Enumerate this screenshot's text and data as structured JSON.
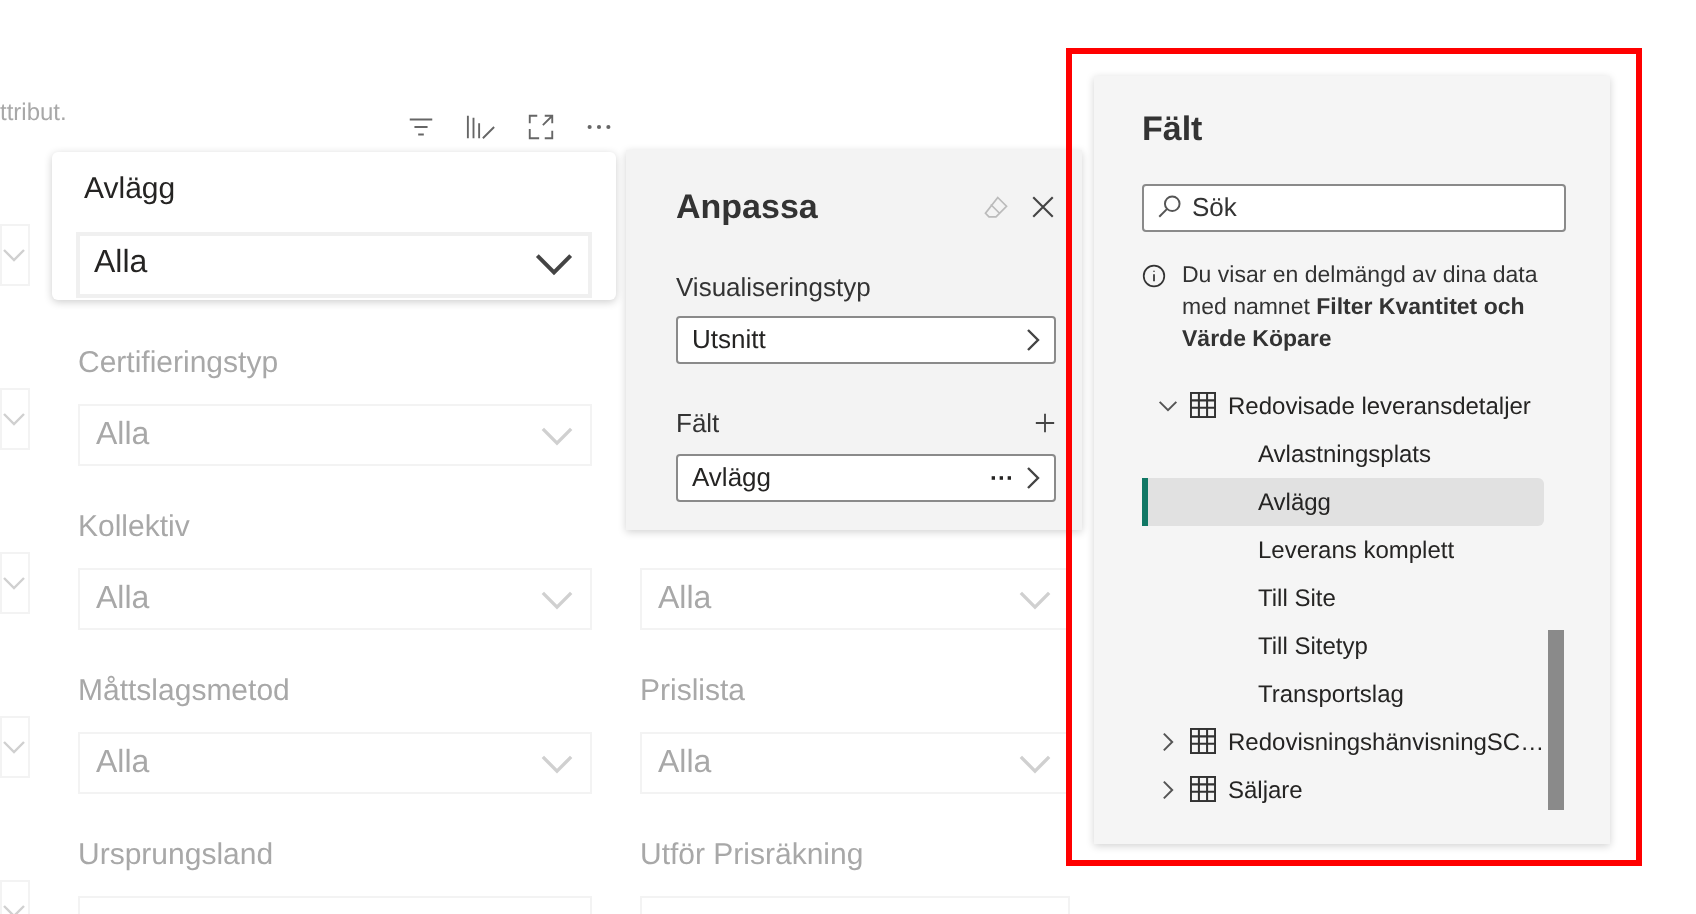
{
  "background": {
    "hint": "ttribut.",
    "middle_column": [
      {
        "label": "Certifieringstyp",
        "value": "Alla"
      },
      {
        "label": "Kollektiv",
        "value": "Alla"
      },
      {
        "label": "Måttslagsmetod",
        "value": "Alla"
      },
      {
        "label": "Ursprungsland"
      }
    ],
    "right_column": [
      {
        "value": "Alla"
      },
      {
        "label": "Prislista",
        "value": "Alla"
      },
      {
        "label": "Utför Prisräkning"
      }
    ]
  },
  "slicer_card": {
    "title": "Avlägg",
    "value": "Alla"
  },
  "customize_panel": {
    "title": "Anpassa",
    "visualization_label": "Visualiseringstyp",
    "visualization_value": "Utsnitt",
    "field_label": "Fält",
    "field_value": "Avlägg",
    "field_more": "···"
  },
  "fields_panel": {
    "title": "Fält",
    "search": {
      "placeholder": "Sök"
    },
    "info": "Du visar en delmängd av dina data med namnet **Filter Kvantitet och Värde Köpare**",
    "tables": [
      {
        "name": "Redovisade leveransdetaljer",
        "expanded": true,
        "children": [
          {
            "name": "Avlastningsplats",
            "selected": false
          },
          {
            "name": "Avlägg",
            "selected": true
          },
          {
            "name": "Leverans komplett",
            "selected": false
          },
          {
            "name": "Till Site",
            "selected": false
          },
          {
            "name": "Till Sitetyp",
            "selected": false
          },
          {
            "name": "Transportslag",
            "selected": false
          }
        ]
      },
      {
        "name": "RedovisningshänvisningSC…",
        "expanded": false
      },
      {
        "name": "Säljare",
        "expanded": false
      }
    ]
  }
}
